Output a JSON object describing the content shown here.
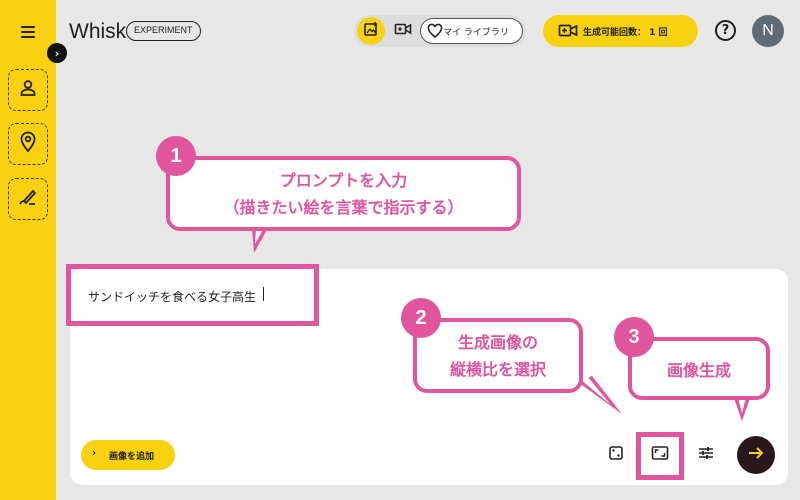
{
  "sidebar": {
    "expand_glyph": "›",
    "items": [
      {
        "icon": "person-icon"
      },
      {
        "icon": "location-pin-icon"
      },
      {
        "icon": "brush-icon"
      }
    ]
  },
  "header": {
    "logo": "Whisk",
    "badge": "EXPERIMENT",
    "library_label": "マイ ライブラリ",
    "quota_label": "生成可能回数： 1 回",
    "help_glyph": "?",
    "avatar_initial": "N"
  },
  "prompt": {
    "text": "サンドイッチを食べる女子高生",
    "add_image_label": "画像を追加",
    "add_image_glyph": "›"
  },
  "annotations": [
    {
      "number": "1",
      "lines": [
        "プロンプトを入力",
        "（描きたい絵を言葉で指示する）"
      ]
    },
    {
      "number": "2",
      "lines": [
        "生成画像の",
        "縦横比を選択"
      ]
    },
    {
      "number": "3",
      "lines": [
        "画像生成"
      ]
    }
  ],
  "colors": {
    "accent_yellow": "#f8d210",
    "annotation_pink": "#e0559c",
    "submit_dark": "#2a171b"
  }
}
